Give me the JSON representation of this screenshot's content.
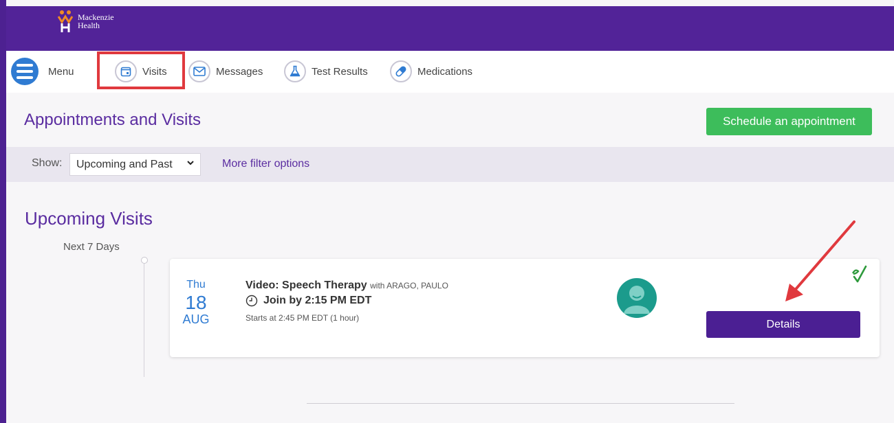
{
  "colors": {
    "brand_purple": "#522398",
    "title_purple": "#5a2ca0",
    "schedule_green": "#3dbd5b",
    "details_purple": "#4b1f93",
    "accent_blue": "#2f7bd2",
    "annotation_red": "#e0393e"
  },
  "header": {
    "logo_line1": "Mackenzie",
    "logo_line2": "Health"
  },
  "nav": {
    "menu_label": "Menu",
    "items": [
      {
        "label": "Visits",
        "icon": "calendar-icon"
      },
      {
        "label": "Messages",
        "icon": "envelope-icon"
      },
      {
        "label": "Test Results",
        "icon": "flask-icon"
      },
      {
        "label": "Medications",
        "icon": "pill-icon"
      }
    ]
  },
  "page": {
    "title": "Appointments and Visits",
    "schedule_button": "Schedule an appointment",
    "filter": {
      "show_label": "Show:",
      "selected": "Upcoming and Past",
      "more_link": "More filter options"
    },
    "upcoming_title": "Upcoming Visits",
    "range_label": "Next 7 Days"
  },
  "visit": {
    "dow": "Thu",
    "day": "18",
    "month": "AUG",
    "title": "Video: Speech Therapy",
    "with": "with ARAGO, PAULO",
    "join": "Join by 2:15 PM EDT",
    "starts": "Starts at 2:45 PM EDT (1 hour)",
    "details_button": "Details"
  }
}
